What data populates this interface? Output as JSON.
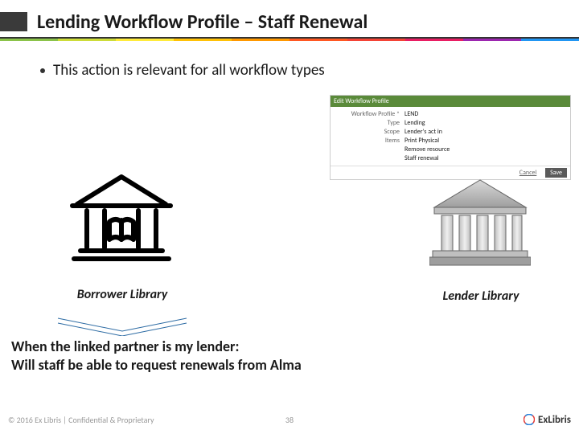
{
  "title": "Lending Workflow Profile – Staff Renewal",
  "bullet": "This action is relevant for all workflow types",
  "mini": {
    "header": "Edit Workflow Profile",
    "name_label": "Workflow Profile *",
    "name_value": "LEND",
    "rows": [
      {
        "label": "Type",
        "value": "Lending"
      },
      {
        "label": "Scope",
        "value": "Lender's act in"
      },
      {
        "label": "Items",
        "value": "Print Physical"
      },
      {
        "label": "",
        "value": "Remove resource"
      },
      {
        "label": "",
        "value": "Staff renewal"
      }
    ],
    "cancel": "Cancel",
    "save": "Save"
  },
  "labels": {
    "borrower": "Borrower Library",
    "lender": "Lender Library"
  },
  "question_line1": "When the linked partner is my lender:",
  "question_line2": "Will staff be able to request renewals from Alma",
  "footer": {
    "left": "© 2016 Ex Libris | Confidential & Proprietary",
    "page": "38",
    "brand": "ExLibris"
  }
}
